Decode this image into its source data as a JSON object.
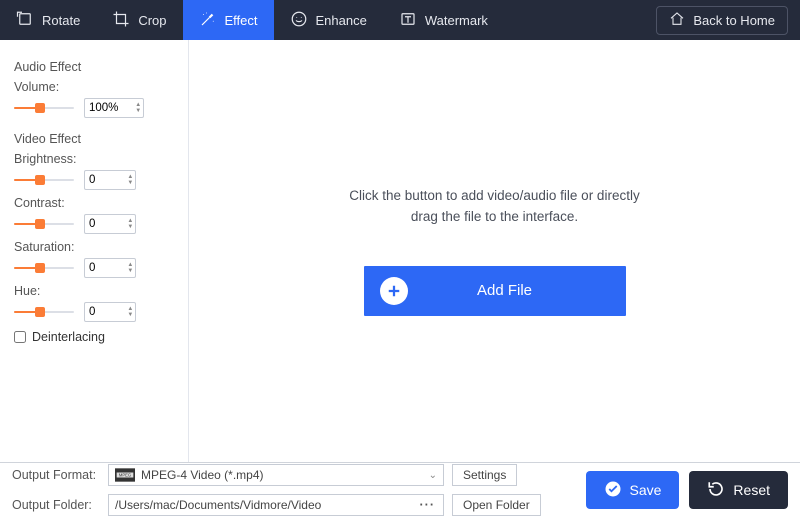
{
  "nav": {
    "rotate": "Rotate",
    "crop": "Crop",
    "effect": "Effect",
    "enhance": "Enhance",
    "watermark": "Watermark",
    "back": "Back to Home"
  },
  "sidebar": {
    "audio_section": "Audio Effect",
    "video_section": "Video Effect",
    "volume_label": "Volume:",
    "volume_value": "100%",
    "brightness_label": "Brightness:",
    "brightness_value": "0",
    "contrast_label": "Contrast:",
    "contrast_value": "0",
    "saturation_label": "Saturation:",
    "saturation_value": "0",
    "hue_label": "Hue:",
    "hue_value": "0",
    "deinterlacing_label": "Deinterlacing"
  },
  "main": {
    "placeholder_line1": "Click the button to add video/audio file or directly",
    "placeholder_line2": "drag the file to the interface.",
    "add_file": "Add File"
  },
  "footer": {
    "format_label": "Output Format:",
    "format_value": "MPEG-4 Video (*.mp4)",
    "settings": "Settings",
    "folder_label": "Output Folder:",
    "folder_value": "/Users/mac/Documents/Vidmore/Video",
    "open_folder": "Open Folder",
    "save": "Save",
    "reset": "Reset"
  }
}
